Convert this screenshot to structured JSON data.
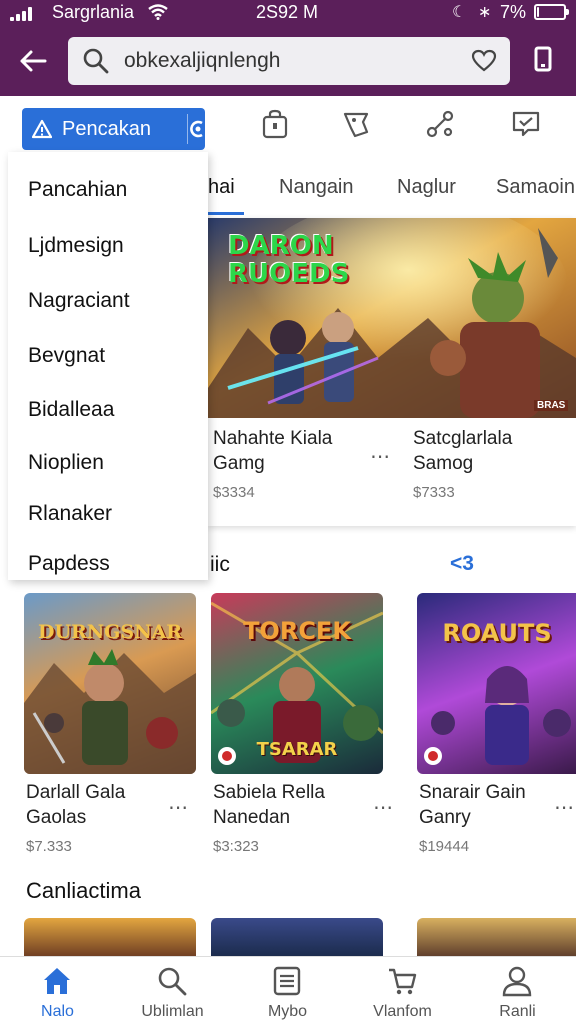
{
  "status_bar": {
    "carrier": "Sargrlania",
    "time": "2S92 M",
    "battery": "7%",
    "battery_level": 0.07
  },
  "search": {
    "value": "obkexaljiqnlengh",
    "placeholder": ""
  },
  "filter_chip": {
    "label": "Pencakan"
  },
  "dropdown": {
    "items": [
      "Pancahian",
      "Ljdmesign",
      "Nagraciant",
      "Bevgnat",
      "Bidalleaa",
      "Nioplien",
      "Rlanaker",
      "Papdess"
    ]
  },
  "tabs": [
    "hai",
    "Nangain",
    "Naglur",
    "Samaoin"
  ],
  "featured": [
    {
      "title_line1": "Nahahte Kiala",
      "title_line2": "Gamg",
      "price": "$3334",
      "art_text": "DARON RUOEDS",
      "badge": "BRAS"
    },
    {
      "title_line1": "Satcglarlala",
      "title_line2": "Samog",
      "price": "$7333"
    }
  ],
  "section1": {
    "title_suffix": "iic",
    "see_more": "<3"
  },
  "games": [
    {
      "title_line1": "Darlall Gala",
      "title_line2": "Gaolas",
      "price": "$7.333",
      "art_text": "DURNGSNAR",
      "accent": "#c9612a"
    },
    {
      "title_line1": "Sabiela Rella",
      "title_line2": "Nanedan",
      "price": "$3:323",
      "art_text": "TORCEK",
      "sub_text": "TSARAR",
      "accent": "#1c8f6a"
    },
    {
      "title_line1": "Snarair Gain",
      "title_line2": "Ganry",
      "price": "$19444",
      "art_text": "ROAUTS",
      "accent": "#6a2fb0"
    }
  ],
  "section2": {
    "title": "Canliactima"
  },
  "bottom_nav": [
    {
      "label": "Nalo",
      "icon": "home-icon",
      "active": true
    },
    {
      "label": "Ublimlan",
      "icon": "search-icon",
      "active": false
    },
    {
      "label": "Mybo",
      "icon": "list-icon",
      "active": false
    },
    {
      "label": "Vlanfom",
      "icon": "cart-icon",
      "active": false
    },
    {
      "label": "Ranli",
      "icon": "profile-icon",
      "active": false
    }
  ],
  "colors": {
    "header": "#5b1f5a",
    "accent": "#2a6fd8",
    "background": "#ffffff"
  }
}
